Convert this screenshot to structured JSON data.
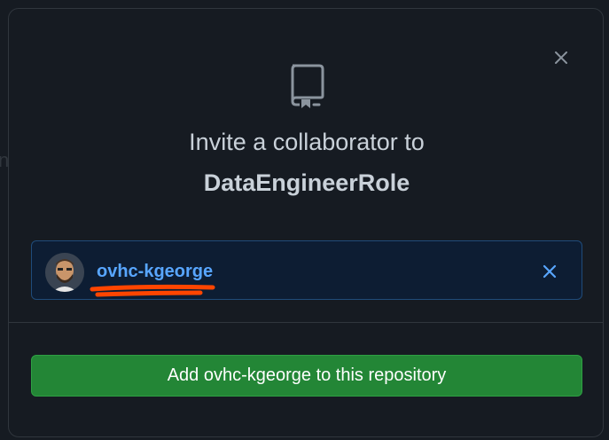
{
  "dialog": {
    "title_prefix": "Invite a collaborator to",
    "repo_name": "DataEngineerRole",
    "close_icon": "close-icon",
    "repo_icon": "repo-icon"
  },
  "selected_user": {
    "username": "ovhc-kgeorge",
    "avatar_icon": "avatar",
    "remove_icon": "x-icon",
    "highlight_color": "#ff4500"
  },
  "add_button": {
    "label": "Add ovhc-kgeorge to this repository"
  },
  "colors": {
    "accent": "#58a6ff",
    "primary_button": "#238636",
    "background": "#161b22"
  }
}
